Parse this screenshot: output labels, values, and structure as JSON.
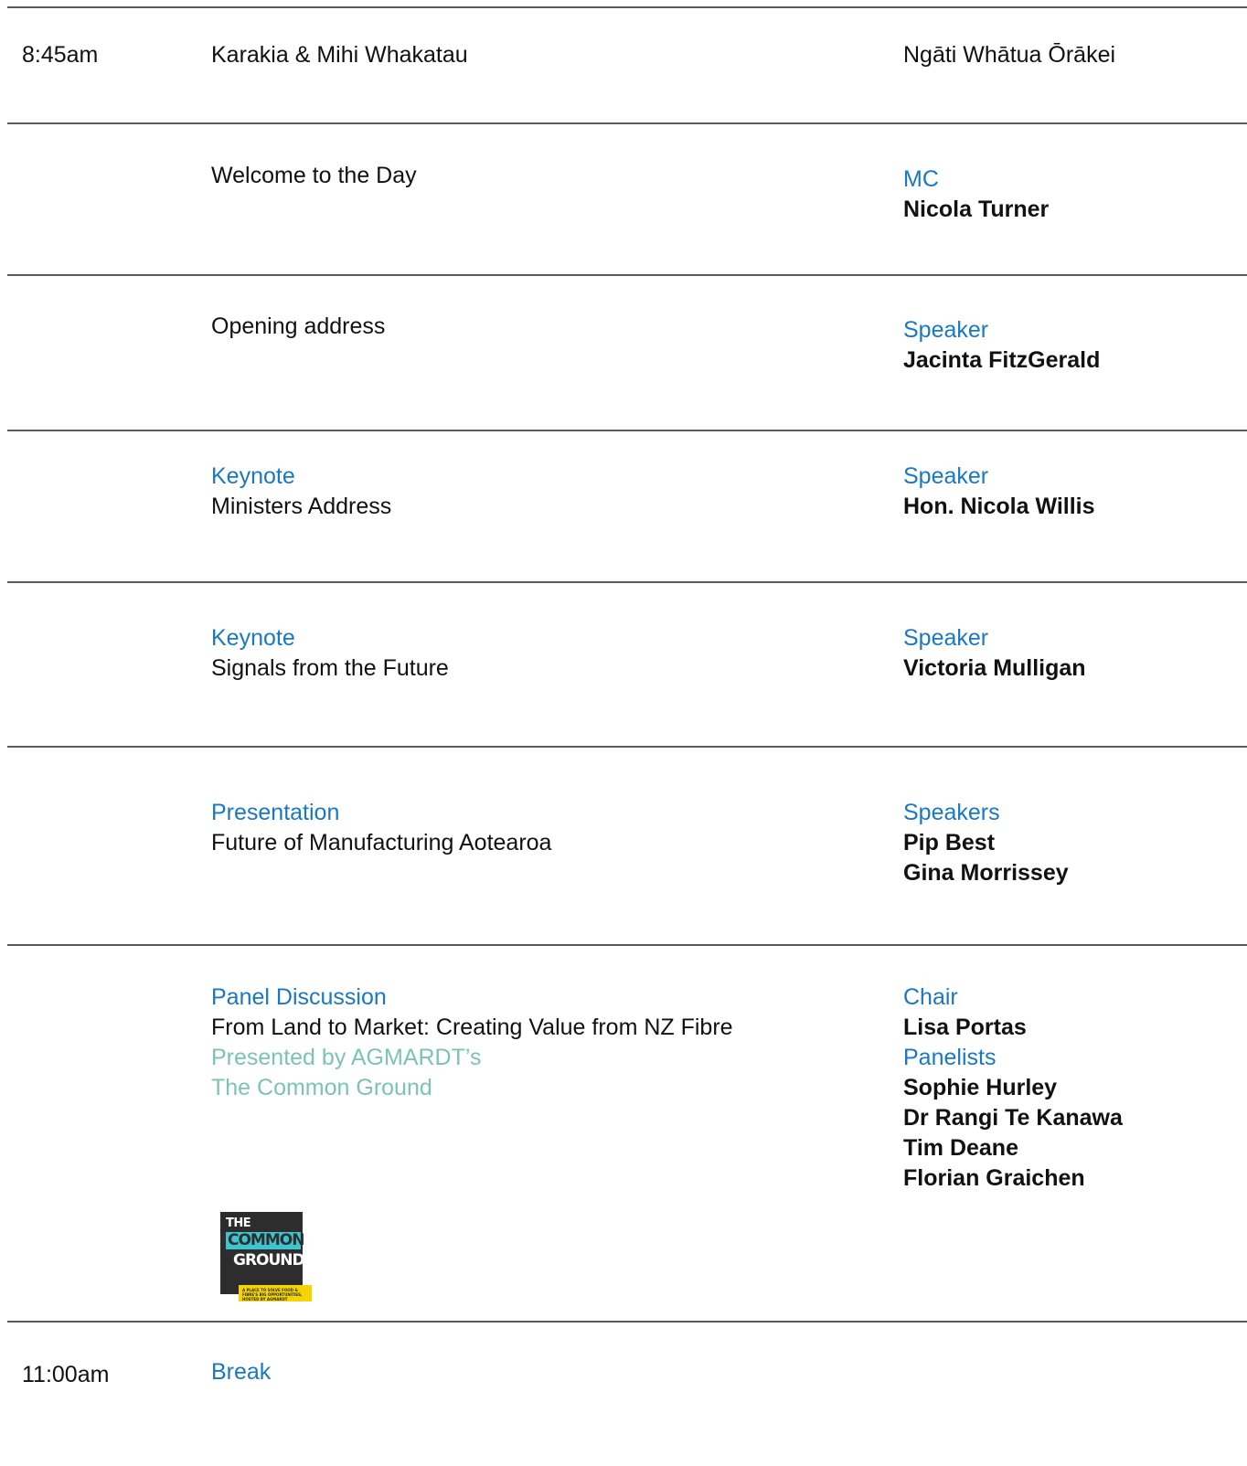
{
  "rows": [
    {
      "time": "8:45am",
      "title": "Karakia & Mihi Whakatau",
      "right_text": "Ngāti Whātua Ōrākei"
    },
    {
      "title": "Welcome to the Day",
      "role": "MC",
      "names": [
        "Nicola Turner"
      ]
    },
    {
      "title": "Opening address",
      "role": "Speaker",
      "names": [
        "Jacinta FitzGerald"
      ]
    },
    {
      "type": "Keynote",
      "title": "Ministers Address",
      "role": "Speaker",
      "names": [
        "Hon. Nicola Willis"
      ]
    },
    {
      "type": "Keynote",
      "title": "Signals from the Future",
      "role": "Speaker",
      "names": [
        "Victoria Mulligan"
      ]
    },
    {
      "type": "Presentation",
      "title": "Future of Manufacturing Aotearoa",
      "role": "Speakers",
      "names": [
        "Pip Best",
        "Gina Morrissey"
      ]
    },
    {
      "type": "Panel Discussion",
      "title": "From Land to Market: Creating Value from NZ Fibre",
      "presented_by": [
        "Presented by AGMARDT’s",
        "The Common Ground"
      ],
      "role": "Chair",
      "names": [
        "Lisa Portas"
      ],
      "role2": "Panelists",
      "names2": [
        "Sophie Hurley",
        "Dr Rangi Te Kanawa",
        "Tim Deane",
        "Florian Graichen"
      ],
      "logo": {
        "line1": "THE",
        "line2": "COMMON",
        "line3": "GROUND",
        "tagline": "A PLACE TO SOLVE FOOD & FIBRE'S BIG OPPORTUNITIES, HOSTED BY AGMARDT"
      }
    },
    {
      "time": "11:00am",
      "type": "Break"
    }
  ],
  "colors": {
    "label_blue": "#1a78c2",
    "presented_teal": "#7cc4b1",
    "rule": "#5a5a5a",
    "logo_cyan": "#3cc4cf",
    "logo_yellow": "#f5d400"
  }
}
